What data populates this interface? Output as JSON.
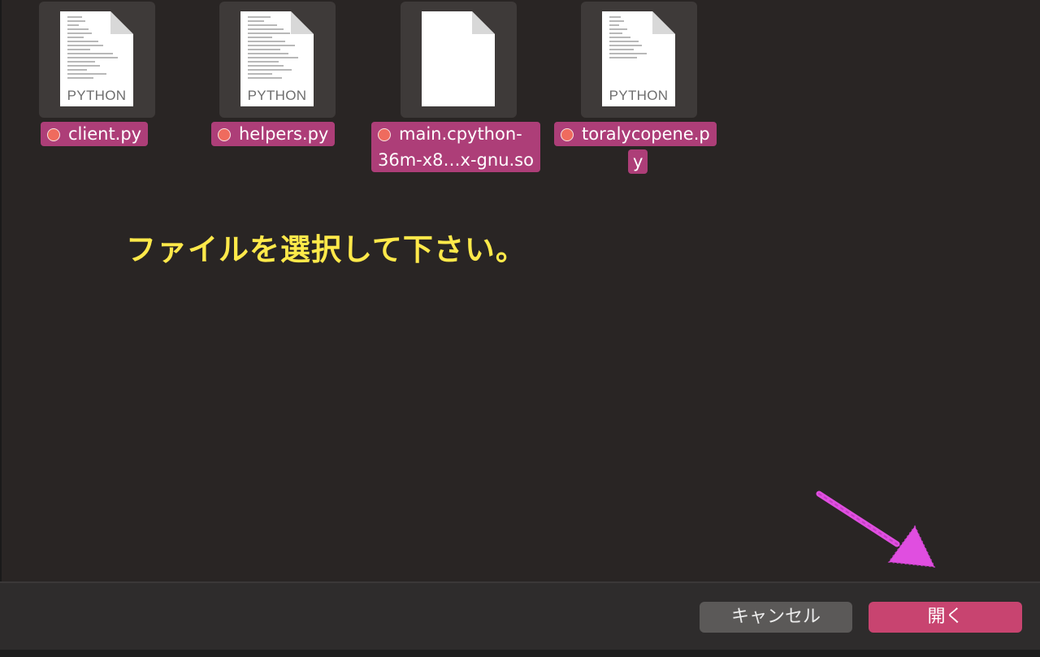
{
  "files": [
    {
      "name": "client.py",
      "type_label": "PYTHON",
      "tag_color": "#ef6b5e",
      "icon": "python-document-icon"
    },
    {
      "name": "helpers.py",
      "type_label": "PYTHON",
      "tag_color": "#ef6b5e",
      "icon": "python-document-icon"
    },
    {
      "name_lines": [
        "main.cpython-",
        "36m-x8…x-gnu.so"
      ],
      "type_label": "",
      "tag_color": "#ef6b5e",
      "icon": "blank-document-icon"
    },
    {
      "name_lines": [
        "toralycopene.p",
        "y"
      ],
      "type_label": "PYTHON",
      "tag_color": "#ef6b5e",
      "icon": "python-document-icon"
    }
  ],
  "instruction": "ファイルを選択して下さい。",
  "buttons": {
    "cancel": "キャンセル",
    "open": "開く"
  },
  "colors": {
    "selection_label": "#ad3e78",
    "instruction_text": "#ffe94a",
    "annotation_arrow": "#e04ee0",
    "primary_button": "#c84470"
  },
  "annotation": {
    "icon": "arrow-pointing-to-open-button"
  }
}
